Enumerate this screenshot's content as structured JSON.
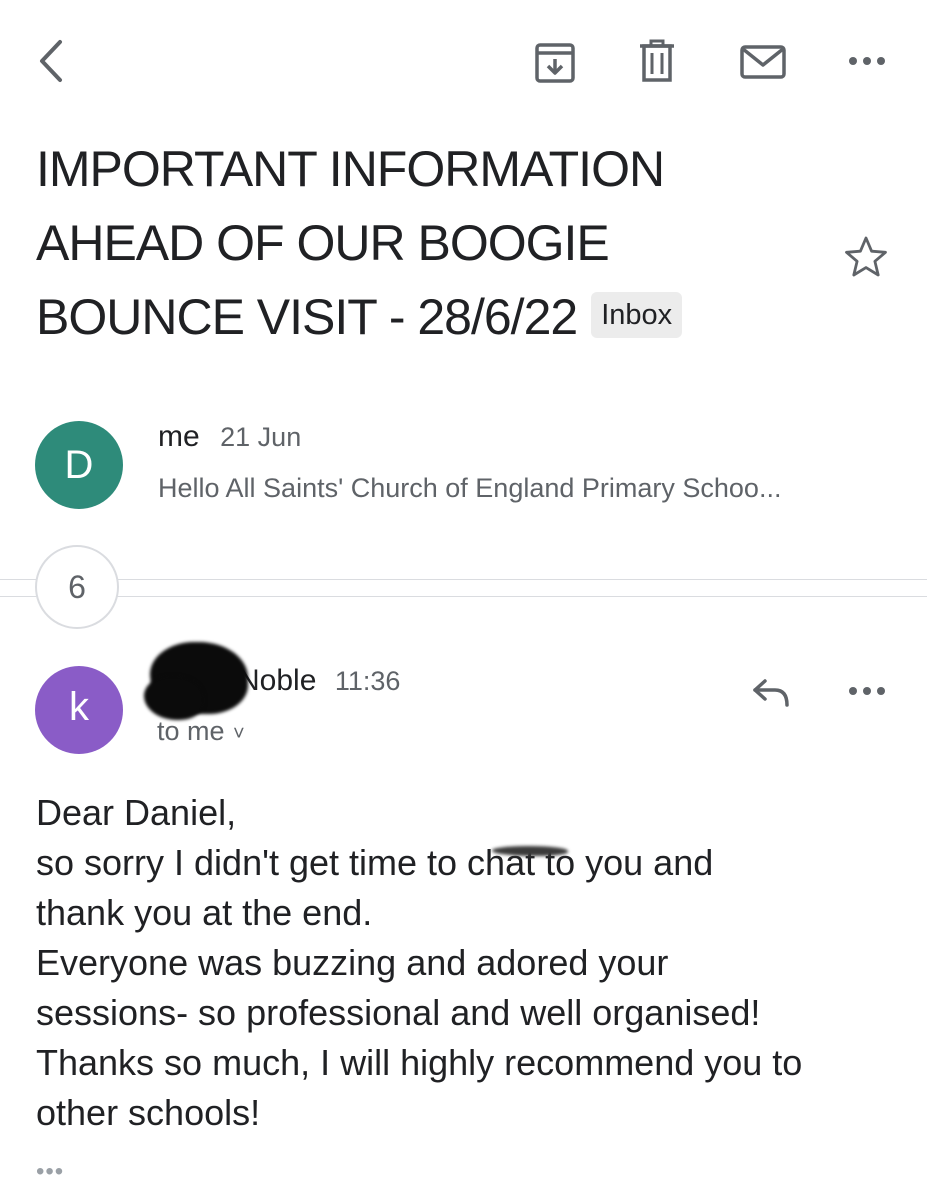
{
  "toolbar": {
    "back_icon": "chevron-left-icon",
    "archive_icon": "archive-icon",
    "delete_icon": "trash-icon",
    "mark_unread_icon": "envelope-icon",
    "more_icon": "more-horizontal-icon"
  },
  "subject": {
    "line1": "IMPORTANT INFORMATION",
    "line2": "AHEAD OF OUR BOOGIE",
    "line3": "BOUNCE VISIT - 28/6/22",
    "label": "Inbox",
    "star_icon": "star-outline-icon"
  },
  "collapsed_message": {
    "avatar_letter": "D",
    "avatar_color": "#2e8b7a",
    "sender": "me",
    "date": "21 Jun",
    "snippet": "Hello All Saints' Church of England Primary Schoo..."
  },
  "thread": {
    "hidden_count": "6"
  },
  "open_message": {
    "avatar_letter": "k",
    "avatar_color": "#8a5cc7",
    "sender": "Noble",
    "time": "11:36",
    "recipient": "to me",
    "recipient_chevron": "˅",
    "reply_icon": "reply-icon",
    "more_icon": "more-horizontal-icon",
    "body_lines": [
      "Dear Daniel,",
      "so sorry I didn't get time to chat to you and",
      "thank you at the end.",
      "Everyone was buzzing and adored your",
      "sessions- so professional and well organised!",
      "Thanks so much, I will highly recommend you to",
      "other schools!"
    ],
    "show_trimmed": "•••"
  },
  "colors": {
    "text_primary": "#202124",
    "text_secondary": "#5f6368",
    "divider": "#dadce0",
    "badge_bg": "#ececec"
  }
}
